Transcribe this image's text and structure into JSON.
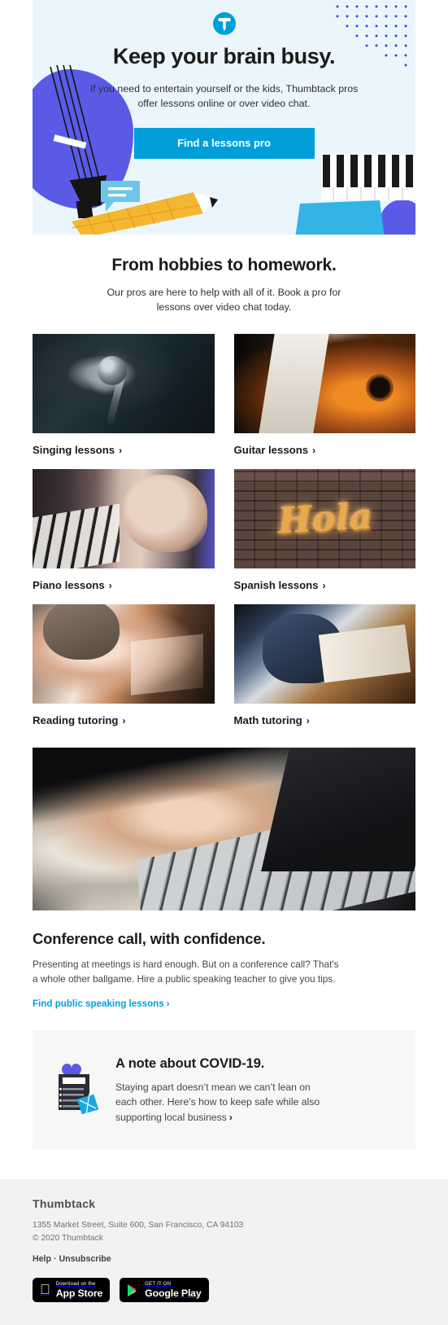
{
  "hero": {
    "logo_icon": "thumbtack-logo-icon",
    "title": "Keep your brain busy.",
    "subtitle": "If you need to entertain yourself or the kids, Thumbtack pros offer lessons online or over video chat.",
    "cta_label": "Find a lessons pro",
    "background_color": "#eaf6fc",
    "cta_color": "#009fd9",
    "art": {
      "cello": "cello-illustration",
      "pencil": "pencil-illustration",
      "speech_bubble": "speech-bubble-illustration",
      "piano_keys": "piano-keys-illustration",
      "dots": "dot-grid-pattern"
    }
  },
  "intro": {
    "title": "From hobbies to homework.",
    "subtitle": "Our pros are here to help with all of it. Book a pro for lessons over video chat today."
  },
  "lessons": [
    {
      "label": "Singing lessons",
      "photo": "microphone-photo",
      "chevron": "›"
    },
    {
      "label": "Guitar lessons",
      "photo": "guitar-player-photo",
      "chevron": "›"
    },
    {
      "label": "Piano lessons",
      "photo": "piano-hands-photo",
      "chevron": "›"
    },
    {
      "label": "Spanish lessons",
      "photo": "hola-sign-photo",
      "chevron": "›"
    },
    {
      "label": "Reading tutoring",
      "photo": "child-reading-photo",
      "chevron": "›"
    },
    {
      "label": "Math tutoring",
      "photo": "child-writing-photo",
      "chevron": "›"
    }
  ],
  "banner": {
    "photo": "hands-typing-laptop-photo"
  },
  "conference": {
    "title": "Conference call, with confidence.",
    "body": "Presenting at meetings is hard enough. But on a conference call? That's a whole other ballgame. Hire a public speaking teacher to give you tips.",
    "link_label": "Find public speaking lessons",
    "link_chevron": "›",
    "link_color": "#009fd9"
  },
  "covid_note": {
    "icon": "clipboard-heart-shield-icon",
    "title": "A note about COVID-19.",
    "body": "Staying apart doesn’t mean we can’t lean on each other. Here’s how to keep safe while also supporting local business",
    "chevron": "›",
    "background_color": "#f7f7f8"
  },
  "footer": {
    "brand": "Thumbtack",
    "address": "1355 Market Street, Suite 600, San Francisco, CA 94103",
    "copyright": "© 2020 Thumbtack",
    "help_label": "Help",
    "separator": "·",
    "unsubscribe_label": "Unsubscribe",
    "background_color": "#f2f2f3",
    "badges": [
      {
        "small": "Download on the",
        "big": "App Store",
        "icon": "apple-logo-icon"
      },
      {
        "small": "GET IT ON",
        "big": "Google Play",
        "icon": "google-play-icon"
      }
    ]
  }
}
